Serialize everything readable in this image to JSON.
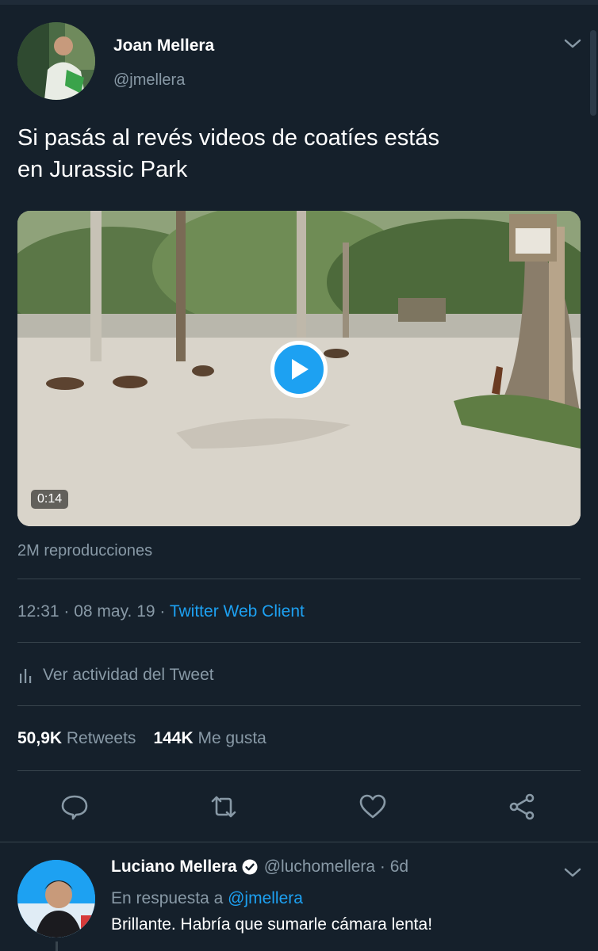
{
  "tweet": {
    "author_name": "Joan Mellera",
    "author_handle": "@jmellera",
    "text_line1": "Si pasás al revés videos de coatíes estás",
    "text_line2": "en Jurassic Park",
    "video_duration": "0:14",
    "views": "2M reproducciones",
    "time_date": "12:31 · 08 may. 19 · ",
    "client": "Twitter Web Client",
    "activity_label": "Ver actividad del Tweet",
    "retweets_count": "50,9K",
    "retweets_label": "Retweets",
    "likes_count": "144K",
    "likes_label": "Me gusta"
  },
  "actions": [
    {
      "name": "reply",
      "icon": "reply-icon"
    },
    {
      "name": "retweet",
      "icon": "retweet-icon"
    },
    {
      "name": "like",
      "icon": "heart-icon"
    },
    {
      "name": "share",
      "icon": "share-icon"
    }
  ],
  "reply": {
    "author_name": "Luciano Mellera",
    "author_handle": "@luchomellera · 6d",
    "in_reply_prefix": "En respuesta a ",
    "in_reply_mention": "@jmellera",
    "text": "Brillante. Habría que sumarle cámara lenta!"
  },
  "colors": {
    "background": "#15202b",
    "accent": "#1da1f2",
    "secondary_text": "#8899a6",
    "divider": "#38444d"
  }
}
